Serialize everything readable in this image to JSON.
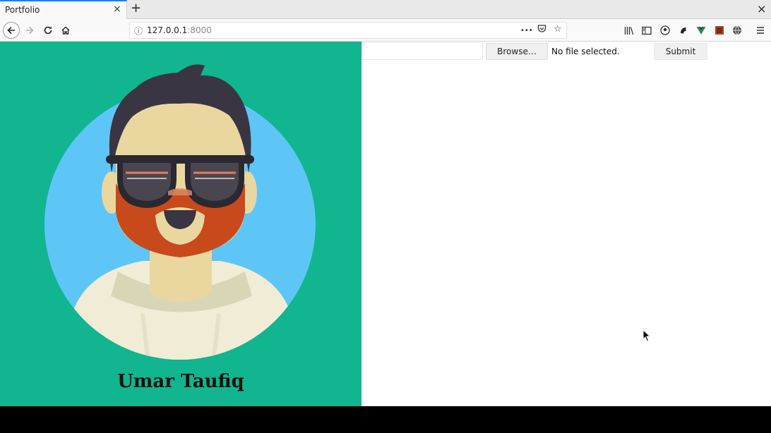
{
  "browser": {
    "tab_title": "Portfolio",
    "tab_close": "×",
    "new_tab": "+",
    "window_close": "×",
    "url_host": "127.0.0.1",
    "url_port": ":8000",
    "page_actions": "•••",
    "icons": [
      "back-icon",
      "forward-icon",
      "reload-icon",
      "home-icon",
      "info-icon",
      "pocket-icon",
      "bookmark-star-icon",
      "library-icon",
      "sidebar-icon",
      "account-icon",
      "extension-icon",
      "vue-devtools-icon",
      "extension-square-icon",
      "extension-globe-icon",
      "menu-icon"
    ]
  },
  "page": {
    "name": "Umar Taufiq",
    "upload": {
      "text_value": "",
      "browse_label": "Browse…",
      "file_status": "No file selected.",
      "submit_label": "Submit"
    }
  },
  "colors": {
    "left_panel": "#11b58f",
    "avatar_circle": "#5ec6f7",
    "beard": "#c84a1c",
    "hair": "#3a3542",
    "skin": "#ead7a0"
  }
}
